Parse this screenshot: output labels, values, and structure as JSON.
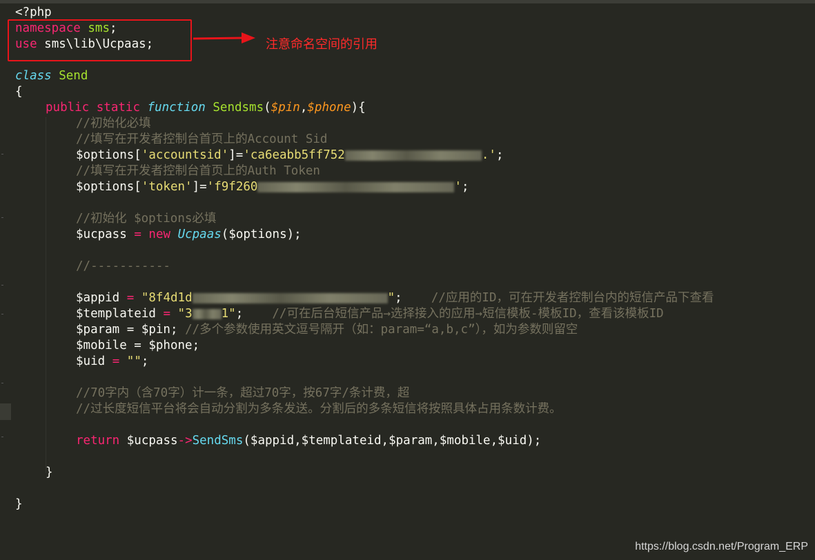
{
  "editor": {
    "lines": {
      "php_open": "<?php",
      "namespace_kw": "namespace",
      "namespace_name": "sms",
      "use_kw": "use",
      "use_path": "sms\\lib\\Ucpaas",
      "class_kw": "class",
      "class_name": "Send",
      "brace_open": "{",
      "fn_public": "public",
      "fn_static": "static",
      "fn_function": "function",
      "fn_name": "Sendsms",
      "fn_param1": "$pin",
      "fn_param2": "$phone",
      "c_init": "//初始化必填",
      "c_sid": "//填写在开发者控制台首页上的Account Sid",
      "opt_sid_key": "'accountsid'",
      "opt_sid_val": "'ca6eabb5ff752",
      "c_token": "//填写在开发者控制台首页上的Auth Token",
      "opt_token_key": "'token'",
      "opt_token_val": "'f9f260",
      "c_init_options": "//初始化 $options必填",
      "ucpass_var": "$ucpass",
      "new_kw": "new",
      "ucpaas_class": "Ucpaas",
      "c_dashes": "//-----------",
      "appid_var": "$appid",
      "appid_val": "\"8f4d1d",
      "c_appid": "//应用的ID，可在开发者控制台内的短信产品下查看",
      "templateid_var": "$templateid",
      "templateid_val": "\"3",
      "c_templateid": "//可在后台短信产品→选择接入的应用→短信模板-模板ID，查看该模板ID",
      "param_line": "$param = $pin;",
      "c_param": "//多个参数使用英文逗号隔开（如：param=“a,b,c”），如为参数则留空",
      "mobile_line": "$mobile = $phone;",
      "uid_var": "$uid",
      "uid_val": "\"\"",
      "c_70_a": "//70字内（含70字）计一条，超过70字，按67字/条计费，超",
      "c_70_b": "//过长度短信平台将会自动分割为多条发送。分割后的多条短信将按照具体占用条数计费。",
      "return_kw": "return",
      "return_obj": "$ucpass",
      "return_method": "SendSms",
      "return_args": "($appid,$templateid,$param,$mobile,$uid);",
      "brace_close_inner": "}",
      "brace_close_outer": "}"
    }
  },
  "annotation": {
    "label": "注意命名空间的引用",
    "color": "#e8141a"
  },
  "watermark": "https://blog.csdn.net/Program_ERP",
  "colors": {
    "background": "#272822",
    "keyword": "#f92672",
    "storage": "#66d9ef",
    "function": "#a6e22e",
    "param": "#fd971f",
    "string": "#e6db74",
    "comment": "#75715e"
  }
}
